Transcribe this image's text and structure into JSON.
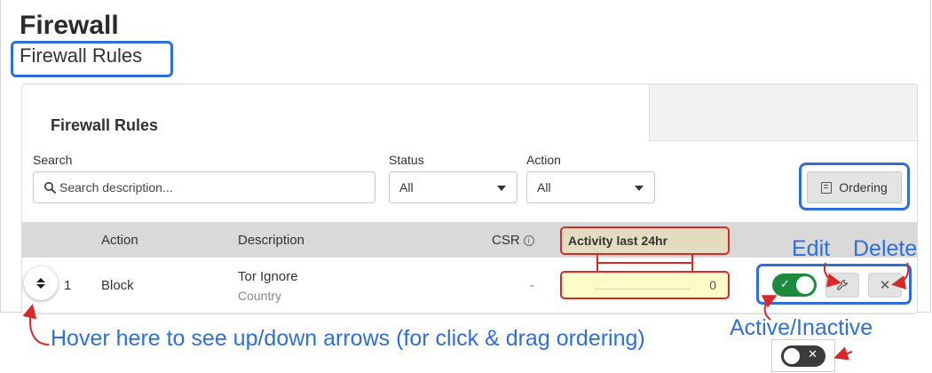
{
  "page": {
    "title": "Firewall",
    "subtitle": "Firewall Rules"
  },
  "card": {
    "title": "Firewall Rules"
  },
  "filters": {
    "search_label": "Search",
    "search_placeholder": "Search description...",
    "status_label": "Status",
    "status_value": "All",
    "action_label": "Action",
    "action_value": "All",
    "ordering_label": "Ordering"
  },
  "table": {
    "columns": {
      "action": "Action",
      "description": "Description",
      "csr": "CSR",
      "activity": "Activity last 24hr"
    },
    "rows": [
      {
        "order": "1",
        "action": "Block",
        "description": "Tor Ignore",
        "description_sub": "Country",
        "csr": "-",
        "activity": "0",
        "active": true
      }
    ]
  },
  "annotations": {
    "edit": "Edit",
    "delete": "Delete",
    "active_inactive": "Active/Inactive",
    "hover_hint": "Hover here to see up/down arrows (for click & drag ordering)"
  },
  "colors": {
    "annotation_blue": "#2f6fd9",
    "highlight_red": "#d62a2a",
    "toggle_active": "#1d8a3d",
    "toggle_inactive": "#3b3b3b",
    "activity_fill": "#fffbc9"
  },
  "icons": {
    "search": "search-icon",
    "ordering": "book-icon",
    "info": "info-icon",
    "edit": "wrench-icon",
    "delete": "close-icon",
    "drag": "sort-arrows-icon"
  }
}
